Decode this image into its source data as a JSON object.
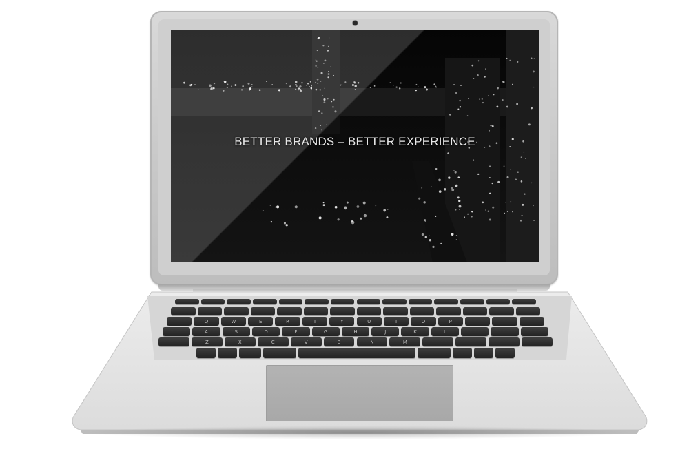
{
  "screen": {
    "headline": "BETTER BRANDS – BETTER EXPERIENCE",
    "background_scene": "night city skyline with river and lit buildings"
  },
  "device": {
    "name": "laptop",
    "lid_color": "#c9c9c9",
    "base_color": "#e3e3e3",
    "key_color": "#2b2b2b",
    "trackpad_color": "#adadad"
  },
  "keyboard": {
    "rows": [
      [
        "",
        "",
        "",
        "",
        "",
        "",
        "",
        "",
        "",
        "",
        "",
        "",
        "",
        ""
      ],
      [
        "",
        "",
        "",
        "",
        "",
        "",
        "",
        "",
        "",
        "",
        "",
        "",
        "",
        ""
      ],
      [
        "",
        "Q",
        "W",
        "E",
        "R",
        "T",
        "Y",
        "U",
        "I",
        "O",
        "P",
        "",
        "",
        ""
      ],
      [
        "",
        "A",
        "S",
        "D",
        "F",
        "G",
        "H",
        "J",
        "K",
        "L",
        "",
        "",
        ""
      ],
      [
        "",
        "Z",
        "X",
        "C",
        "V",
        "B",
        "N",
        "M",
        "",
        "",
        "",
        ""
      ],
      [
        "",
        "",
        "",
        "",
        "",
        "",
        "",
        "",
        ""
      ]
    ]
  }
}
